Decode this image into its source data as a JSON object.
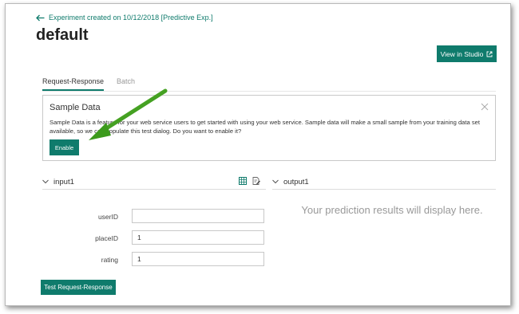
{
  "header": {
    "back_link": "Experiment created on 10/12/2018 [Predictive Exp.]",
    "title": "default",
    "studio_button": "View in Studio"
  },
  "tabs": [
    {
      "label": "Request-Response",
      "active": true
    },
    {
      "label": "Batch",
      "active": false
    }
  ],
  "sample_data": {
    "title": "Sample Data",
    "description": "Sample Data is a feature for your web service users to get started with using your web service. Sample data will make a small sample from your training data set available, so we can populate this test dialog. Do you want to enable it?",
    "enable_button": "Enable"
  },
  "input": {
    "title": "input1",
    "fields": [
      {
        "label": "userID",
        "value": ""
      },
      {
        "label": "placeID",
        "value": "1"
      },
      {
        "label": "rating",
        "value": "1"
      }
    ]
  },
  "output": {
    "title": "output1",
    "placeholder": "Your prediction results will display here."
  },
  "test_button": "Test Request-Response",
  "colors": {
    "accent": "#0f7b6c",
    "annotation_arrow": "#3c9a1c"
  }
}
